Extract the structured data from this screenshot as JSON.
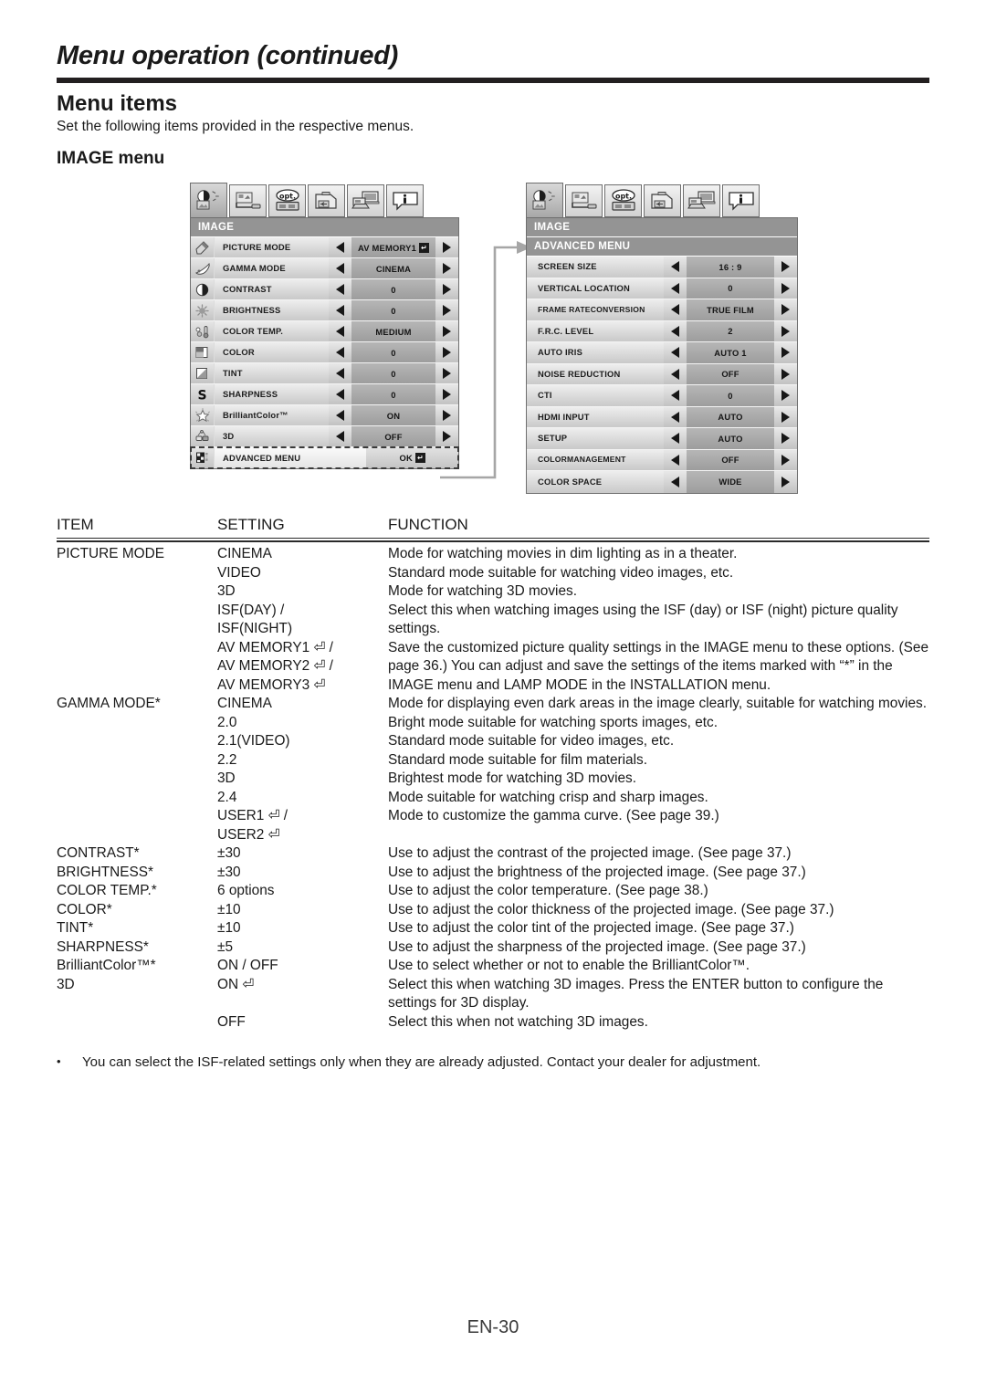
{
  "header": {
    "title": "Menu operation (continued)",
    "section_title": "Menu items",
    "intro": "Set the following items provided in the respective menus.",
    "subsection_title": "IMAGE menu"
  },
  "osd_left": {
    "tabs": [
      "image-tab-icon",
      "installation-tab-icon",
      "option-tab-icon",
      "signal-tab-icon",
      "network-tab-icon",
      "information-tab-icon"
    ],
    "header": "IMAGE",
    "rows": [
      {
        "icon": "picture-mode-icon",
        "label": "PICTURE MODE",
        "value": "AV MEMORY1",
        "enter": true
      },
      {
        "icon": "gamma-mode-icon",
        "label": "GAMMA MODE",
        "value": "CINEMA",
        "enter": false
      },
      {
        "icon": "contrast-icon",
        "label": "CONTRAST",
        "value": "0",
        "enter": false
      },
      {
        "icon": "brightness-icon",
        "label": "BRIGHTNESS",
        "value": "0",
        "enter": false
      },
      {
        "icon": "color-temp-icon",
        "label": "COLOR TEMP.",
        "value": "MEDIUM",
        "enter": false
      },
      {
        "icon": "color-icon",
        "label": "COLOR",
        "value": "0",
        "enter": false
      },
      {
        "icon": "tint-icon",
        "label": "TINT",
        "value": "0",
        "enter": false
      },
      {
        "icon": "sharpness-icon",
        "label": "SHARPNESS",
        "value": "0",
        "enter": false
      },
      {
        "icon": "brilliantcolor-icon",
        "label": "BrilliantColor™",
        "value": "ON",
        "enter": false
      },
      {
        "icon": "three-d-icon",
        "label": "3D",
        "value": "OFF",
        "enter": false
      },
      {
        "icon": "advanced-menu-icon",
        "label": "ADVANCED MENU",
        "value": "OK",
        "enter": true,
        "selected": true,
        "ok": true
      }
    ]
  },
  "osd_right": {
    "tabs": [
      "image-tab-icon",
      "installation-tab-icon",
      "option-tab-icon",
      "signal-tab-icon",
      "network-tab-icon",
      "information-tab-icon"
    ],
    "header": "IMAGE",
    "subheader": "ADVANCED MENU",
    "rows": [
      {
        "label": "SCREEN SIZE",
        "value": "16 : 9"
      },
      {
        "label": "VERTICAL LOCATION",
        "value": "0"
      },
      {
        "label": "FRAME RATE\nCONVERSION",
        "value": "TRUE FILM",
        "two_line": true
      },
      {
        "label": "F.R.C. LEVEL",
        "value": "2"
      },
      {
        "label": "AUTO IRIS",
        "value": "AUTO 1"
      },
      {
        "label": "NOISE REDUCTION",
        "value": "OFF"
      },
      {
        "label": "CTI",
        "value": "0"
      },
      {
        "label": "HDMI INPUT",
        "value": "AUTO"
      },
      {
        "label": "SETUP",
        "value": "AUTO"
      },
      {
        "label": "COLOR\nMANAGEMENT",
        "value": "OFF",
        "two_line": true
      },
      {
        "label": "COLOR SPACE",
        "value": "WIDE"
      }
    ]
  },
  "table": {
    "columns": [
      "ITEM",
      "SETTING",
      "FUNCTION"
    ],
    "rows": [
      {
        "item": "PICTURE MODE",
        "setting": "CINEMA",
        "function": "Mode for watching movies in dim lighting as in a theater."
      },
      {
        "item": "",
        "setting": "VIDEO",
        "function": "Standard mode suitable for watching video images, etc."
      },
      {
        "item": "",
        "setting": "3D",
        "function": "Mode for watching 3D movies."
      },
      {
        "item": "",
        "setting": "ISF(DAY) /\nISF(NIGHT)",
        "function": "Select this when watching images using the ISF (day) or ISF (night) picture quality settings."
      },
      {
        "item": "",
        "setting": "AV MEMORY1 ⏎ /\nAV MEMORY2 ⏎ /\nAV MEMORY3 ⏎",
        "function": "Save the customized picture quality settings in the IMAGE menu to these options. (See page 36.) You can adjust and save the settings of the items marked with “*” in the IMAGE menu and LAMP MODE in the INSTALLATION menu."
      },
      {
        "item": "GAMMA MODE*",
        "setting": "CINEMA",
        "function": "Mode for displaying even dark areas in the image clearly, suitable for watching movies."
      },
      {
        "item": "",
        "setting": "2.0",
        "function": "Bright mode suitable for watching sports images, etc."
      },
      {
        "item": "",
        "setting": "2.1(VIDEO)",
        "function": "Standard mode suitable for video images, etc."
      },
      {
        "item": "",
        "setting": "2.2",
        "function": "Standard mode suitable for film materials."
      },
      {
        "item": "",
        "setting": "3D",
        "function": "Brightest mode for watching 3D movies."
      },
      {
        "item": "",
        "setting": "2.4",
        "function": "Mode suitable for watching crisp and sharp images."
      },
      {
        "item": "",
        "setting": "USER1 ⏎ /\nUSER2 ⏎",
        "function": "Mode to customize the gamma curve. (See page 39.)"
      },
      {
        "item": "CONTRAST*",
        "setting": "±30",
        "function": "Use to adjust the contrast of the projected image. (See page 37.)"
      },
      {
        "item": "BRIGHTNESS*",
        "setting": "±30",
        "function": "Use to adjust the brightness of the projected image. (See page 37.)"
      },
      {
        "item": "COLOR TEMP.*",
        "setting": "6 options",
        "function": "Use to adjust the color temperature. (See page 38.)"
      },
      {
        "item": "COLOR*",
        "setting": "±10",
        "function": "Use to adjust the color thickness of the projected image. (See page 37.)"
      },
      {
        "item": "TINT*",
        "setting": "±10",
        "function": "Use to adjust the color tint of the projected image. (See page 37.)"
      },
      {
        "item": "SHARPNESS*",
        "setting": "±5",
        "function": "Use to adjust the sharpness of the projected image. (See page 37.)"
      },
      {
        "item": "BrilliantColor™*",
        "setting": "ON / OFF",
        "function": "Use to select whether or not to enable the BrilliantColor™."
      },
      {
        "item": "3D",
        "setting": "ON ⏎",
        "function": "Select this when watching 3D images. Press the ENTER button to configure the settings for 3D display."
      },
      {
        "item": "",
        "setting": "OFF",
        "function": "Select this when not watching 3D images."
      }
    ]
  },
  "note": {
    "bullet": "•",
    "text": "You can select the ISF-related settings only when they are already adjusted. Contact your dealer for adjustment."
  },
  "footer": {
    "page_number": "EN-30"
  }
}
